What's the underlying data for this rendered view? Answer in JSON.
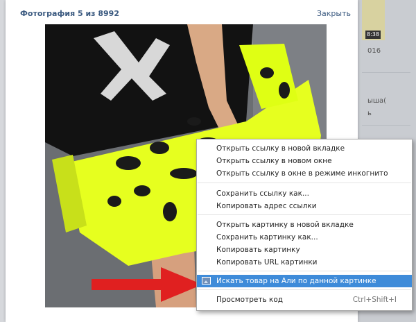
{
  "viewer": {
    "title": "Фотография 5 из 8992",
    "close_label": "Закрыть"
  },
  "background": {
    "thumb_badge": "8:38",
    "fragments": [
      "016",
      "ыша(",
      "ь"
    ]
  },
  "context_menu": {
    "items": [
      {
        "label": "Открыть ссылку в новой вкладке"
      },
      {
        "label": "Открыть ссылку в новом окне"
      },
      {
        "label": "Открыть ссылку в окне в режиме инкогнито"
      },
      {
        "label": "Сохранить ссылку как..."
      },
      {
        "label": "Копировать адрес ссылки"
      },
      {
        "label": "Открыть картинку в новой вкладке"
      },
      {
        "label": "Сохранить картинку как..."
      },
      {
        "label": "Копировать картинку"
      },
      {
        "label": "Копировать URL картинки"
      },
      {
        "label": "Искать товар на Али по данной картинке",
        "icon": "extension-image-icon",
        "highlighted": true
      },
      {
        "label": "Просмотреть код",
        "shortcut": "Ctrl+Shift+I"
      }
    ]
  },
  "colors": {
    "link": "#3b5a80",
    "highlight": "#3e8bd9",
    "bag_neon": "#e6ff1f",
    "arrow": "#e02020"
  },
  "icons": [
    "photo-clutch-bag",
    "red-arrow-icon",
    "extension-image-icon"
  ]
}
